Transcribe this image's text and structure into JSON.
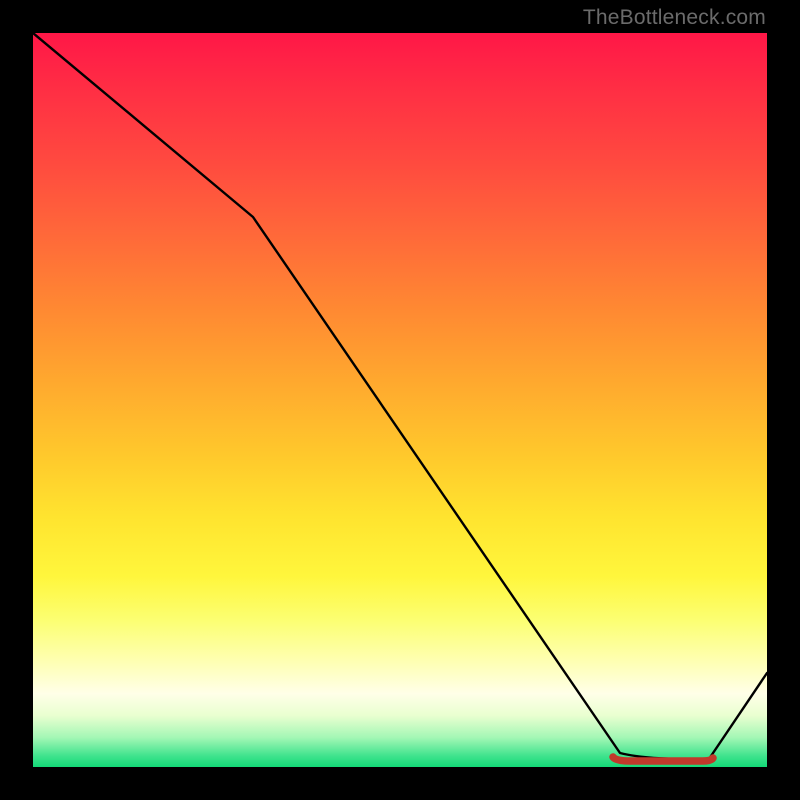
{
  "watermark": "TheBottleneck.com",
  "chart_data": {
    "type": "line",
    "title": "",
    "xlabel": "",
    "ylabel": "",
    "xlim": [
      0,
      100
    ],
    "ylim": [
      0,
      100
    ],
    "x": [
      0,
      30,
      80,
      92,
      100
    ],
    "values": [
      100,
      75,
      2,
      1,
      13
    ],
    "highlight_band_x": [
      79,
      92
    ],
    "gradient_stops": [
      {
        "pos": 0,
        "color": "#ff1747"
      },
      {
        "pos": 0.5,
        "color": "#ffca2c"
      },
      {
        "pos": 0.8,
        "color": "#fcff72"
      },
      {
        "pos": 0.9,
        "color": "#ffffe8"
      },
      {
        "pos": 1.0,
        "color": "#13d977"
      }
    ]
  }
}
